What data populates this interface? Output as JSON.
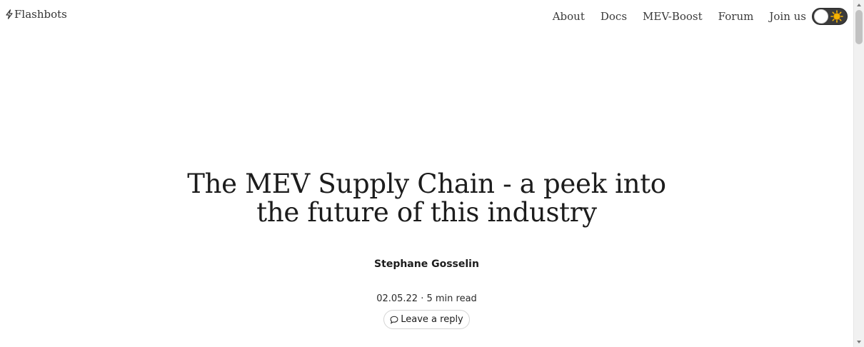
{
  "header": {
    "brand": {
      "icon": "lightning-bolt-icon",
      "label": "Flashbots"
    },
    "nav": [
      {
        "label": "About"
      },
      {
        "label": "Docs"
      },
      {
        "label": "MEV-Boost"
      },
      {
        "label": "Forum"
      },
      {
        "label": "Join us"
      }
    ],
    "theme_toggle": {
      "icon": "sun-icon",
      "state": "light"
    }
  },
  "article": {
    "title_line1": "The MEV Supply Chain - a peek into",
    "title_line2": "the future of this industry",
    "author": "Stephane Gosselin",
    "meta": "02.05.22 · 5 min read",
    "reply": {
      "icon": "speech-bubble-icon",
      "label": "Leave a reply"
    }
  },
  "colors": {
    "text": "#1c1c1c",
    "toggle_bg": "#3b3b3b",
    "sun": "#f5b400",
    "border": "#d4d4d4"
  }
}
